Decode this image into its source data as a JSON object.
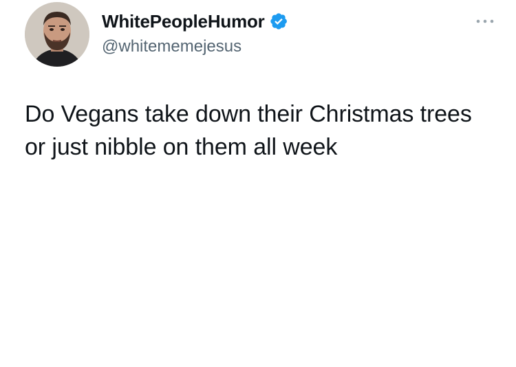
{
  "tweet": {
    "display_name": "WhitePeopleHumor",
    "handle": "@whitememejesus",
    "verified": true,
    "text": "Do Vegans take down their Christmas trees or just nibble on them all week",
    "more_icon": "more-horizontal-icon"
  },
  "colors": {
    "verified_blue": "#1d9bf0",
    "name": "#0f1419",
    "handle": "#536471",
    "more": "#9aa5ad"
  }
}
